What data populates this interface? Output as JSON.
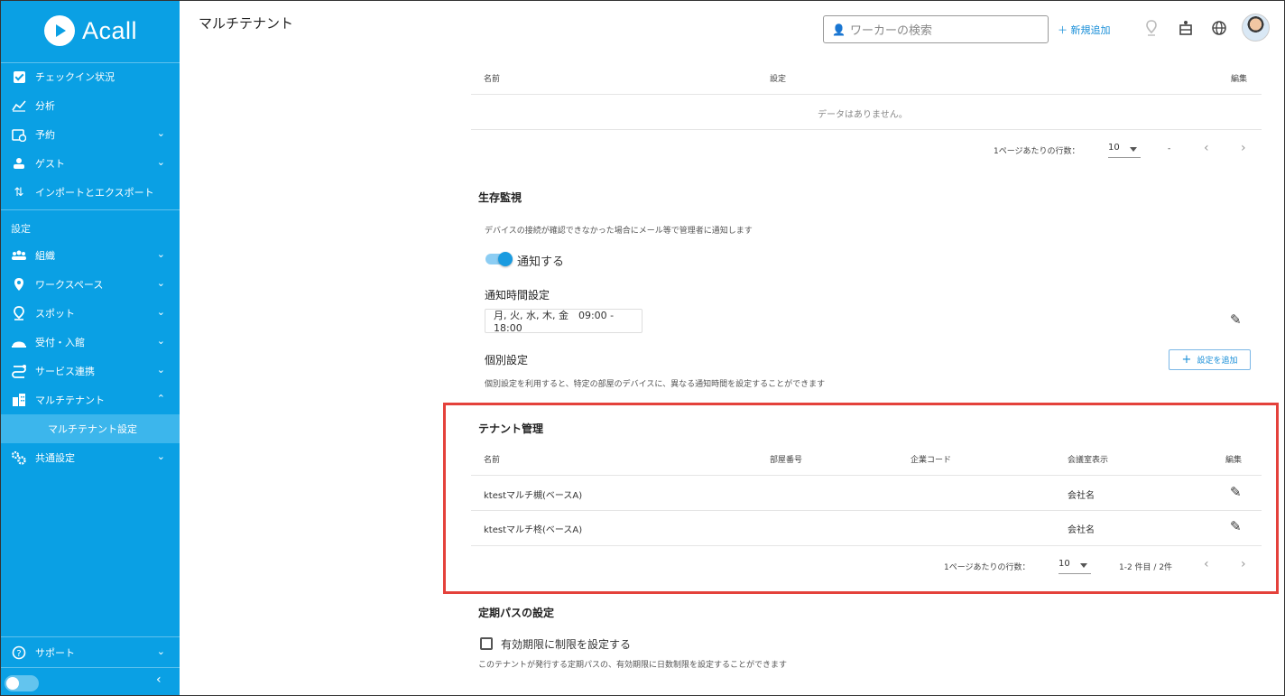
{
  "app": {
    "logo_text": "Acall"
  },
  "sidebar": {
    "items": [
      {
        "label": "チェックイン状況",
        "icon": "checkbox-icon"
      },
      {
        "label": "分析",
        "icon": "chart-icon"
      },
      {
        "label": "予約",
        "icon": "calendar-icon"
      },
      {
        "label": "ゲスト",
        "icon": "guest-icon"
      },
      {
        "label": "インポートとエクスポート",
        "icon": "import-export-icon"
      }
    ],
    "settings_label": "設定",
    "settings_items": [
      {
        "label": "組織",
        "icon": "people-icon"
      },
      {
        "label": "ワークスペース",
        "icon": "location-pin-icon"
      },
      {
        "label": "スポット",
        "icon": "spot-pin-icon"
      },
      {
        "label": "受付・入館",
        "icon": "reception-bell-icon"
      },
      {
        "label": "サービス連携",
        "icon": "service-link-icon"
      },
      {
        "label": "マルチテナント",
        "icon": "building-icon"
      },
      {
        "label": "マルチテナント設定",
        "icon": ""
      },
      {
        "label": "共通設定",
        "icon": "gears-icon"
      }
    ],
    "support_label": "サポート"
  },
  "header": {
    "title": "マルチテナント",
    "search_placeholder": "ワーカーの検索",
    "new_add": "＋ 新規追加"
  },
  "top_table": {
    "headers": [
      "名前",
      "設定",
      "編集"
    ],
    "empty_text": "データはありません。",
    "rows_per_page_label": "1ページあたりの行数：",
    "rows_per_page": "10",
    "range": "-"
  },
  "monitoring": {
    "title": "生存監視",
    "description": "デバイスの接続が確認できなかった場合にメール等で管理者に通知します",
    "toggle_label": "通知する",
    "notify_time_title": "通知時間設定",
    "notify_time_value": "月, 火, 水, 木, 金　09:00 - 18:00",
    "individual_title": "個別設定",
    "individual_description": "個別設定を利用すると、特定の部屋のデバイスに、異なる通知時間を設定することができます",
    "add_button": "設定を追加"
  },
  "tenant": {
    "title": "テナント管理",
    "headers": [
      "名前",
      "部屋番号",
      "企業コード",
      "会議室表示",
      "編集"
    ],
    "rows": [
      {
        "name": "ktestマルチ槻(ベースA)",
        "room": "",
        "company_code": "",
        "display": "会社名"
      },
      {
        "name": "ktestマルチ柊(ベースA)",
        "room": "",
        "company_code": "",
        "display": "会社名"
      }
    ],
    "rows_per_page_label": "1ページあたりの行数：",
    "rows_per_page": "10",
    "range": "1-2 件目 / 2件"
  },
  "pass": {
    "title": "定期パスの設定",
    "checkbox_label": "有効期限に制限を設定する",
    "description": "このテナントが発行する定期パスの、有効期限に日数制限を設定することができます"
  },
  "colors": {
    "sidebar": "#0aa0e4",
    "highlight": "#e4413b",
    "accent": "#1a8fd8"
  }
}
